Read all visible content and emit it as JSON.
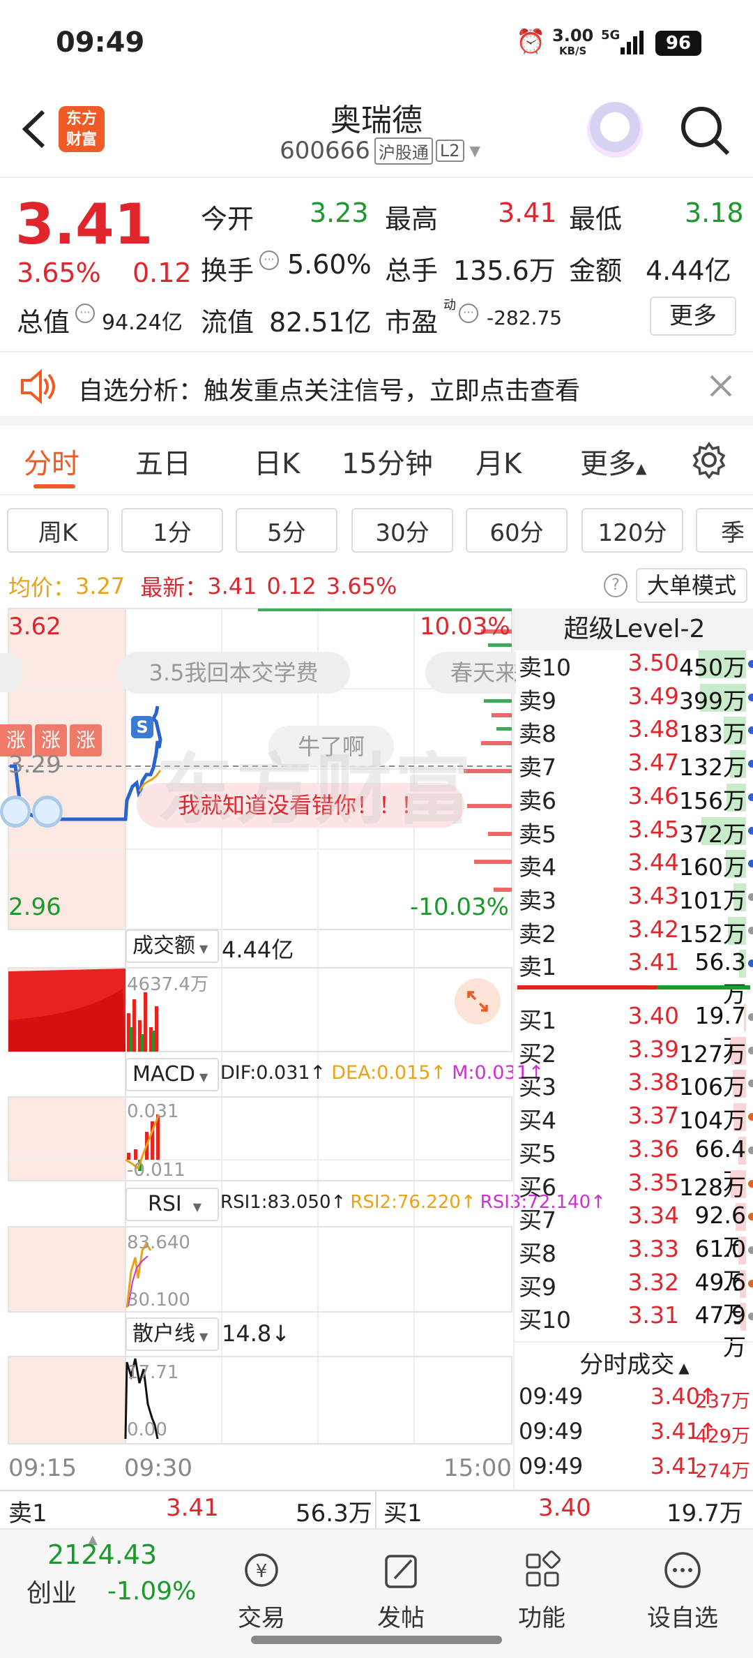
{
  "status": {
    "time": "09:49",
    "net_speed": "3.00",
    "net_unit": "KB/S",
    "network": "5G",
    "battery": "96"
  },
  "header": {
    "logo_line1": "东方",
    "logo_line2": "财富",
    "stock_name": "奥瑞德",
    "stock_code": "600666",
    "exchange_tag": "沪股通",
    "level_tag": "L2"
  },
  "quote": {
    "price": "3.41",
    "change_pct": "3.65%",
    "change": "0.12",
    "open_label": "今开",
    "open": "3.23",
    "high_label": "最高",
    "high": "3.41",
    "low_label": "最低",
    "low": "3.18",
    "turnover_label": "换手",
    "turnover": "5.60%",
    "volume_label": "总手",
    "volume": "135.6万",
    "amount_label": "金额",
    "amount": "4.44亿",
    "mktcap_label": "总值",
    "mktcap": "94.24亿",
    "float_label": "流值",
    "float_cap": "82.51亿",
    "pe_label": "市盈",
    "pe_sup": "动",
    "pe": "-282.75",
    "more_button": "更多"
  },
  "notice": {
    "text": "自选分析：触发重点关注信号，立即点击查看"
  },
  "tabs": [
    "分时",
    "五日",
    "日K",
    "15分钟",
    "月K",
    "更多"
  ],
  "subtabs": [
    "周K",
    "1分",
    "5分",
    "30分",
    "60分",
    "120分",
    "季"
  ],
  "infoline": {
    "avg_label": "均价：",
    "avg": "3.27",
    "latest_label": "最新：",
    "latest": "3.41",
    "chg": "0.12",
    "pct": "3.65%",
    "big_order_mode": "大单模式"
  },
  "chart": {
    "y_top": "3.62",
    "y_bottom": "2.96",
    "y_mid": "3.29",
    "pct_top": "10.03%",
    "pct_bottom": "-10.03%",
    "danmaku": [
      "3.5我回本交学费",
      "春天来",
      "牛了啊",
      "我就知道没看错你！！！"
    ],
    "zhang": "涨",
    "s_marker": "S",
    "watermark": "东方财富",
    "t_start": "09:15",
    "t_open": "09:30",
    "t_end": "15:00"
  },
  "panels": {
    "vol_label": "成交额",
    "vol_value": "4.44亿",
    "vol_axis": "4637.4万",
    "macd_label": "MACD",
    "macd_dif": "DIF:0.031↑",
    "macd_dea": "DEA:0.015↑",
    "macd_m": "M:0.031↑",
    "macd_top": "0.031",
    "macd_bottom": "-0.011",
    "rsi_label": "RSI",
    "rsi1": "RSI1:83.050↑",
    "rsi2": "RSI2:76.220↑",
    "rsi3": "RSI3:72.140↑",
    "rsi_top": "83.640",
    "rsi_bottom": "30.100",
    "retail_label": "散户线",
    "retail_value": "14.8↓",
    "retail_top": "17.71",
    "retail_bottom": "0.00"
  },
  "level2": {
    "title": "超级Level-2",
    "asks": [
      {
        "label": "卖10",
        "price": "3.50",
        "vol": "450万",
        "dot": "#2a62d0"
      },
      {
        "label": "卖9",
        "price": "3.49",
        "vol": "399万",
        "dot": "#2a62d0"
      },
      {
        "label": "卖8",
        "price": "3.48",
        "vol": "183万",
        "dot": "#2a62d0"
      },
      {
        "label": "卖7",
        "price": "3.47",
        "vol": "132万",
        "dot": "#2a62d0"
      },
      {
        "label": "卖6",
        "price": "3.46",
        "vol": "156万",
        "dot": "#2a62d0"
      },
      {
        "label": "卖5",
        "price": "3.45",
        "vol": "372万",
        "dot": "#2a62d0"
      },
      {
        "label": "卖4",
        "price": "3.44",
        "vol": "160万",
        "dot": "#2a62d0"
      },
      {
        "label": "卖3",
        "price": "3.43",
        "vol": "101万",
        "dot": "#999999"
      },
      {
        "label": "卖2",
        "price": "3.42",
        "vol": "152万",
        "dot": "#999999"
      },
      {
        "label": "卖1",
        "price": "3.41",
        "vol": "56.3万",
        "dot": "#2a62d0"
      }
    ],
    "bids": [
      {
        "label": "买1",
        "price": "3.40",
        "vol": "19.7万",
        "dot": "#999999"
      },
      {
        "label": "买2",
        "price": "3.39",
        "vol": "127万",
        "dot": "#999999"
      },
      {
        "label": "买3",
        "price": "3.38",
        "vol": "106万",
        "dot": "#999999"
      },
      {
        "label": "买4",
        "price": "3.37",
        "vol": "104万",
        "dot": "#e8641a"
      },
      {
        "label": "买5",
        "price": "3.36",
        "vol": "66.4万",
        "dot": "#999999"
      },
      {
        "label": "买6",
        "price": "3.35",
        "vol": "128万",
        "dot": "#e8641a"
      },
      {
        "label": "买7",
        "price": "3.34",
        "vol": "92.6万",
        "dot": "#e8641a"
      },
      {
        "label": "买8",
        "price": "3.33",
        "vol": "61.0万",
        "dot": "#999999"
      },
      {
        "label": "买9",
        "price": "3.32",
        "vol": "49.6万",
        "dot": "#e8641a"
      },
      {
        "label": "买10",
        "price": "3.31",
        "vol": "47.9万",
        "dot": "#999999"
      }
    ],
    "trades_title": "分时成交",
    "trades": [
      {
        "time": "09:49",
        "price": "3.40",
        "vol": "237万",
        "arrow": "↑"
      },
      {
        "time": "09:49",
        "price": "3.41",
        "vol": "429万",
        "arrow": "↑"
      },
      {
        "time": "09:49",
        "price": "3.41",
        "vol": "274万",
        "arrow": ""
      }
    ]
  },
  "bottom_ob": {
    "ask_label": "卖1",
    "ask_price": "3.41",
    "ask_vol": "56.3万",
    "bid_label": "买1",
    "bid_price": "3.40",
    "bid_vol": "19.7万"
  },
  "nav": {
    "index_value": "2124.43",
    "index_name": "创业",
    "index_pct": "-1.09%",
    "trade": "交易",
    "post": "发帖",
    "func": "功能",
    "watch": "设自选"
  }
}
